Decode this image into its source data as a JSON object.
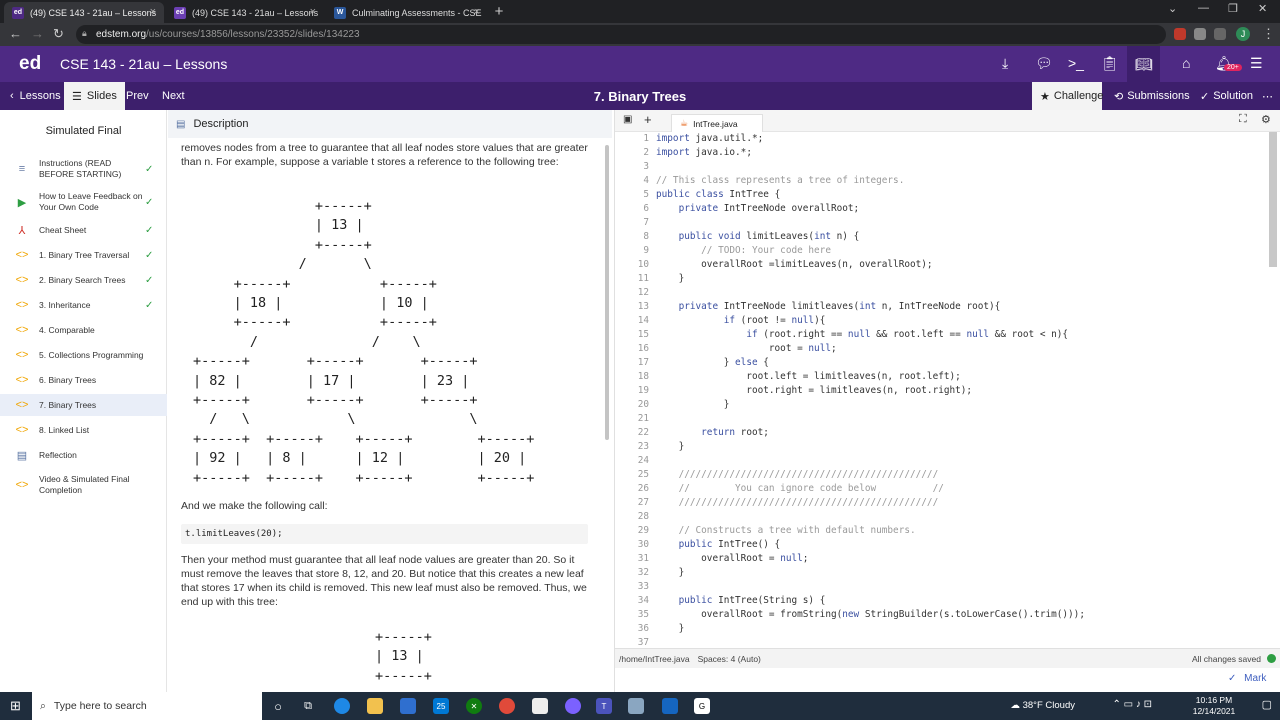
{
  "browser": {
    "tabs": [
      {
        "favicon": "ed",
        "title": "(49) CSE 143 - 21au – Lessons",
        "active": true
      },
      {
        "favicon": "ed",
        "title": "(49) CSE 143 - 21au – Lessons",
        "active": false
      },
      {
        "favicon": "W",
        "title": "Culminating Assessments - CSE",
        "active": false
      }
    ],
    "url_host": "edstem.org",
    "url_path": "/us/courses/13856/lessons/23352/slides/134223"
  },
  "header": {
    "logo": "ed",
    "course_title": "CSE 143 - 21au – Lessons",
    "notification_count": "20+",
    "avatar_letter": "J"
  },
  "toolbar": {
    "lessons": "Lessons",
    "slides": "Slides",
    "prev": "Prev",
    "next": "Next",
    "title": "7. Binary Trees",
    "challenge": "Challenge",
    "submissions": "Submissions",
    "solution": "Solution"
  },
  "sidebar": {
    "title": "Simulated Final",
    "items": [
      {
        "icon": "document-icon",
        "label": "Instructions (READ BEFORE STARTING)",
        "done": true
      },
      {
        "icon": "play-icon",
        "label": "How to Leave Feedback on Your Own Code",
        "done": true
      },
      {
        "icon": "pdf-icon",
        "label": "Cheat Sheet",
        "done": true
      },
      {
        "icon": "code-icon",
        "label": "1. Binary Tree Traversal",
        "done": true
      },
      {
        "icon": "code-icon",
        "label": "2. Binary Search Trees",
        "done": true
      },
      {
        "icon": "code-icon",
        "label": "3. Inheritance",
        "done": true
      },
      {
        "icon": "code-icon",
        "label": "4. Comparable",
        "done": false
      },
      {
        "icon": "code-icon",
        "label": "5. Collections Programming",
        "done": false
      },
      {
        "icon": "code-icon",
        "label": "6. Binary Trees",
        "done": false
      },
      {
        "icon": "code-icon",
        "label": "7. Binary Trees",
        "done": false
      },
      {
        "icon": "code-icon",
        "label": "8. Linked List",
        "done": false
      },
      {
        "icon": "reflection-icon",
        "label": "Reflection",
        "done": false
      },
      {
        "icon": "code-icon",
        "label": "Video & Simulated Final Completion",
        "done": false
      }
    ]
  },
  "description": {
    "header": "Description",
    "para1": "removes nodes from a tree to guarantee that all leaf nodes store values that are greater than n. For example, suppose a variable t stores a reference to the following tree:",
    "tree1": "               +-----+\n               | 13 |\n               +-----+\n             /       \\\n     +-----+           +-----+\n     | 18 |            | 10 |\n     +-----+           +-----+\n       /              /    \\\n+-----+       +-----+       +-----+\n| 82 |        | 17 |        | 23 |\n+-----+       +-----+       +-----+\n  /   \\            \\              \\\n+-----+  +-----+    +-----+        +-----+\n| 92 |   | 8 |      | 12 |         | 20 |\n+-----+  +-----+    +-----+        +-----+",
    "para2": "And we make the following call:",
    "call": "t.limitLeaves(20);",
    "para3": "Then your method must guarantee that all leaf node values are greater than 20. So it must remove the leaves that store 8, 12, and 20. But notice that this creates a new leaf that stores 17 when its child is removed. This new leaf must also be removed. Thus, we end up with this tree:",
    "tree2": "+-----+\n| 13 |\n+-----+"
  },
  "editor": {
    "filename": "IntTree.java",
    "lines": [
      {
        "n": "1",
        "t": "import java.util.*;"
      },
      {
        "n": "2",
        "t": "import java.io.*;"
      },
      {
        "n": "3",
        "t": ""
      },
      {
        "n": "4",
        "t": "// This class represents a tree of integers."
      },
      {
        "n": "5",
        "t": "public class IntTree {"
      },
      {
        "n": "6",
        "t": "    private IntTreeNode overallRoot;"
      },
      {
        "n": "7",
        "t": ""
      },
      {
        "n": "8",
        "t": "    public void limitLeaves(int n) {"
      },
      {
        "n": "9",
        "t": "        // TODO: Your code here"
      },
      {
        "n": "10",
        "t": "        overallRoot =limitLeaves(n, overallRoot);"
      },
      {
        "n": "11",
        "t": "    }"
      },
      {
        "n": "12",
        "t": ""
      },
      {
        "n": "13",
        "t": "    private IntTreeNode limitleaves(int n, IntTreeNode root){"
      },
      {
        "n": "14",
        "t": "            if (root != null){"
      },
      {
        "n": "15",
        "t": "                if (root.right == null && root.left == null && root < n){"
      },
      {
        "n": "16",
        "t": "                    root = null;"
      },
      {
        "n": "17",
        "t": "            } else {"
      },
      {
        "n": "18",
        "t": "                root.left = limitleaves(n, root.left);"
      },
      {
        "n": "19",
        "t": "                root.right = limitleaves(n, root.right);"
      },
      {
        "n": "20",
        "t": "            }"
      },
      {
        "n": "21",
        "t": ""
      },
      {
        "n": "22",
        "t": "        return root;"
      },
      {
        "n": "23",
        "t": "    }"
      },
      {
        "n": "24",
        "t": ""
      },
      {
        "n": "25",
        "t": "    //////////////////////////////////////////////"
      },
      {
        "n": "26",
        "t": "    //        You can ignore code below          //"
      },
      {
        "n": "27",
        "t": "    //////////////////////////////////////////////"
      },
      {
        "n": "28",
        "t": ""
      },
      {
        "n": "29",
        "t": "    // Constructs a tree with default numbers."
      },
      {
        "n": "30",
        "t": "    public IntTree() {"
      },
      {
        "n": "31",
        "t": "        overallRoot = null;"
      },
      {
        "n": "32",
        "t": "    }"
      },
      {
        "n": "33",
        "t": ""
      },
      {
        "n": "34",
        "t": "    public IntTree(String s) {"
      },
      {
        "n": "35",
        "t": "        overallRoot = fromString(new StringBuilder(s.toLowerCase().trim()));"
      },
      {
        "n": "36",
        "t": "    }"
      },
      {
        "n": "37",
        "t": ""
      }
    ],
    "status_path": "/home/IntTree.java",
    "status_spaces": "Spaces: 4 (Auto)",
    "status_saved": "All changes saved",
    "mark": "Mark"
  },
  "taskbar": {
    "search_placeholder": "Type here to search",
    "weather": "38°F  Cloudy",
    "time": "10:16 PM",
    "date": "12/14/2021",
    "mail_count": "25"
  }
}
